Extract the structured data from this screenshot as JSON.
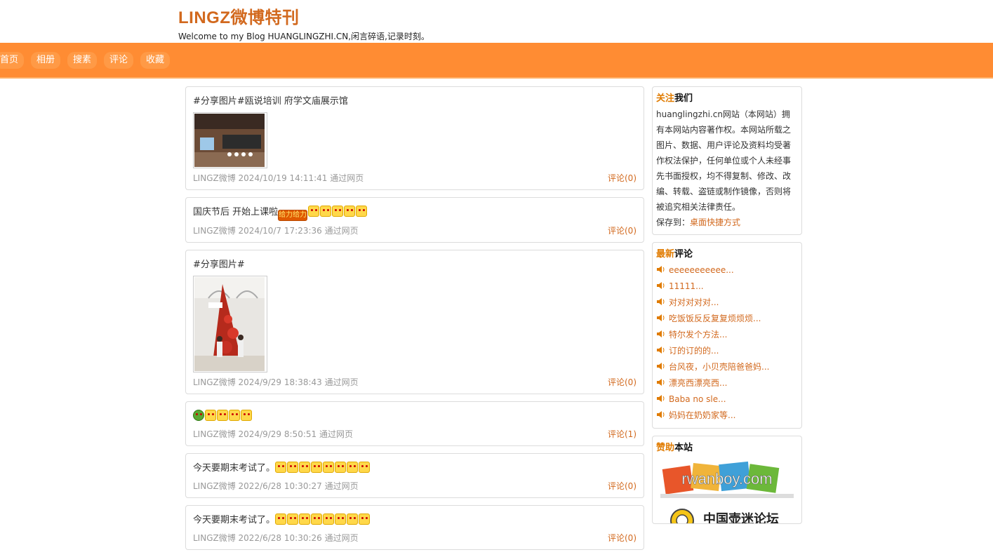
{
  "header": {
    "title": "LINGZ微博特刊",
    "description": "Welcome to my Blog HUANGLINGZHI.CN,闲言碎语,记录时刻。"
  },
  "nav": [
    "首页",
    "相册",
    "搜素",
    "评论",
    "收藏"
  ],
  "posts": [
    {
      "text": "#分享图片#瓯说培训 府学文庙展示馆",
      "meta": "LINGZ微博 2024/10/19 14:11:41 通过网页",
      "comments": "评论(0)"
    },
    {
      "text": "国庆节后 开始上课啦",
      "badge": "给力给力",
      "meta": "LINGZ微博 2024/10/7 17:23:36 通过网页",
      "comments": "评论(0)"
    },
    {
      "text": "#分享图片#",
      "meta": "LINGZ微博 2024/9/29 18:38:43 通过网页",
      "comments": "评论(0)"
    },
    {
      "meta": "LINGZ微博 2024/9/29 8:50:51 通过网页",
      "comments": "评论(1)"
    },
    {
      "text": "今天要期末考试了。",
      "meta": "LINGZ微博 2022/6/28 10:30:27 通过网页",
      "comments": "评论(0)"
    },
    {
      "text": "今天要期末考试了。",
      "meta": "LINGZ微博 2022/6/28 10:30:26 通过网页",
      "comments": "评论(0)"
    }
  ],
  "sidebar": {
    "about": {
      "title_hl": "关注",
      "title_rest": "我们",
      "text": "huanglingzhi.cn网站（本网站）拥有本网站内容著作权。本网站所载之图片、数据、用户评论及资料均受著作权法保护，任何单位或个人未经事先书面授权，均不得复制、修改、改编、转载、盗链或制作镜像，否则将被追究相关法律责任。",
      "save_label": "保存到：",
      "save_link": "桌面快捷方式"
    },
    "latest": {
      "title_hl": "最新",
      "title_rest": "评论",
      "items": [
        "eeeeeeeeeee...",
        "11111...",
        "对对对对对...",
        "吃饭饭反反复复烦烦烦...",
        "特尔发个方法...",
        "订的订的的...",
        "台风夜，小贝壳陪爸爸妈...",
        "漂亮西漂亮西...",
        "Baba no sle...",
        "妈妈在奶奶家等..."
      ]
    },
    "sponsor": {
      "title_hl": "赞助",
      "title_rest": "本站",
      "logo1": "rwanboy.com",
      "logo2": "中国壶迷论坛"
    }
  },
  "colors": {
    "accent": "#ff8c33",
    "link": "#d2691e",
    "title": "#d2691e"
  }
}
